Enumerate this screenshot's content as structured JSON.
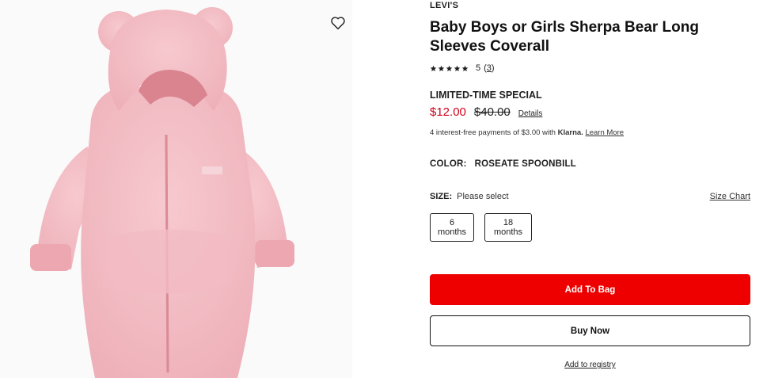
{
  "product": {
    "brand": "LEVI'S",
    "title": "Baby Boys or Girls Sherpa Bear Long Sleeves Coverall",
    "image_alt": "pink sherpa bear coverall",
    "rating": {
      "stars": 5,
      "value": "5",
      "count": "3",
      "star_color": "#1f1f1f"
    }
  },
  "pricing": {
    "promo_label": "LIMITED-TIME SPECIAL",
    "sale_price": "$12.00",
    "original_price": "$40.00",
    "details_link": "Details",
    "sale_color": "#d0021b",
    "installments": {
      "prefix": "4 interest-free payments of $3.00 with",
      "provider": "Klarna.",
      "link": "Learn More"
    }
  },
  "color": {
    "label": "COLOR:",
    "value": "ROSEATE SPOONBILL"
  },
  "size": {
    "label": "SIZE:",
    "prompt": "Please select",
    "chart_link": "Size Chart",
    "options": [
      "6 months",
      "18 months"
    ]
  },
  "actions": {
    "add_to_bag": "Add To Bag",
    "buy_now": "Buy Now",
    "registry": "Add to registry",
    "primary_color": "#ee0000"
  },
  "icons": {
    "wishlist": "heart-outline-icon",
    "star": "star-icon"
  }
}
